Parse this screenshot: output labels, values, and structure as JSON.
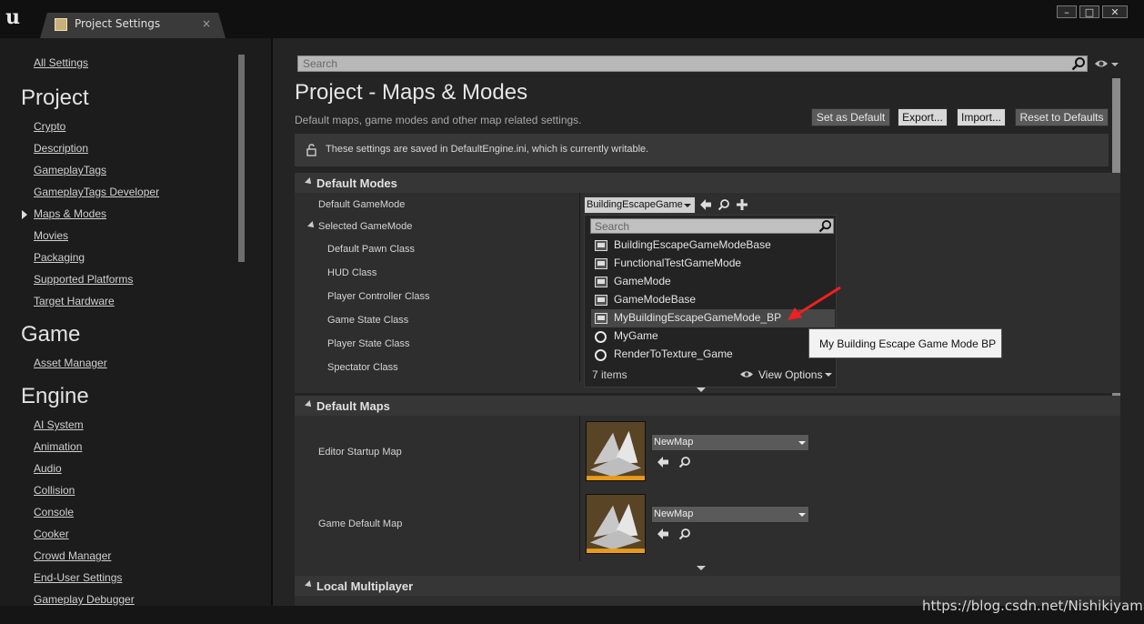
{
  "window": {
    "tab_label": "Project Settings",
    "tab_close": "×",
    "logo": "u",
    "buttons": {
      "minimize": "–",
      "maximize": "□",
      "close": "✕"
    }
  },
  "leftnav": {
    "all_settings": "All Settings",
    "project_heading": "Project",
    "project_items": [
      "Crypto",
      "Description",
      "GameplayTags",
      "GameplayTags Developer",
      "Maps & Modes",
      "Movies",
      "Packaging",
      "Supported Platforms",
      "Target Hardware"
    ],
    "game_heading": "Game",
    "game_items": [
      "Asset Manager"
    ],
    "engine_heading": "Engine",
    "engine_items": [
      "AI System",
      "Animation",
      "Audio",
      "Collision",
      "Console",
      "Cooker",
      "Crowd Manager",
      "End-User Settings",
      "Gameplay Debugger"
    ]
  },
  "search": {
    "placeholder": "Search"
  },
  "header": {
    "title": "Project - Maps & Modes",
    "subtitle": "Default maps, game modes and other map related settings.",
    "buttons": {
      "set_default": "Set as Default",
      "export": "Export...",
      "import": "Import...",
      "reset": "Reset to Defaults"
    }
  },
  "info_bar": {
    "text": "These settings are saved in DefaultEngine.ini, which is currently writable."
  },
  "default_modes": {
    "title": "Default Modes",
    "default_gamemode_label": "Default GameMode",
    "gamemode_value": "BuildingEscapeGame",
    "selected_gamemode_label": "Selected GameMode",
    "sub_labels": [
      "Default Pawn Class",
      "HUD Class",
      "Player Controller Class",
      "Game State Class",
      "Player State Class",
      "Spectator Class"
    ]
  },
  "popup": {
    "search_placeholder": "Search",
    "items": [
      "BuildingEscapeGameModeBase",
      "FunctionalTestGameMode",
      "GameMode",
      "GameModeBase",
      "MyBuildingEscapeGameMode_BP",
      "MyGame",
      "RenderToTexture_Game"
    ],
    "item_count": "7 items",
    "view_options": "View Options",
    "tooltip": "My Building Escape Game Mode BP"
  },
  "default_maps": {
    "title": "Default Maps",
    "editor_startup_label": "Editor Startup Map",
    "editor_startup_value": "NewMap",
    "game_default_label": "Game Default Map",
    "game_default_value": "NewMap"
  },
  "local_multiplayer": {
    "title": "Local Multiplayer"
  },
  "watermark": "https://blog.csdn.net/Nishikiyama"
}
